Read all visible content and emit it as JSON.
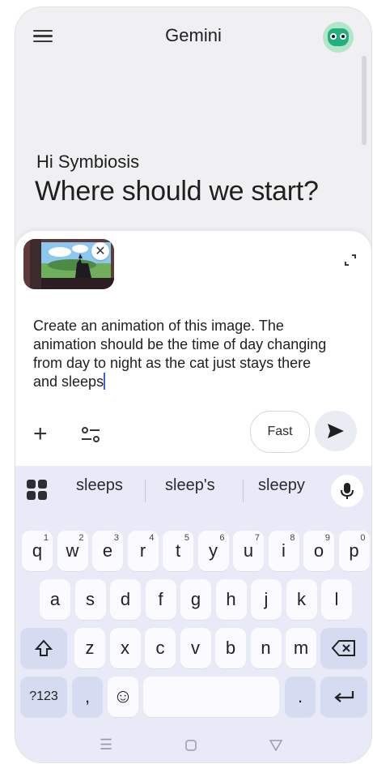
{
  "app": {
    "title": "Gemini"
  },
  "greeting": "Hi Symbiosis",
  "question": "Where should we start?",
  "composer": {
    "prompt_text": "Create an animation of this image. The animation should be the time of day changing from day to night as the cat just stays there and sleeps",
    "fast_label": "Fast",
    "icons": {
      "add": "plus-icon",
      "tools": "tools-icon",
      "send": "send-icon",
      "expand": "expand-icon",
      "remove": "close-icon"
    }
  },
  "keyboard": {
    "suggestions": [
      "sleeps",
      "sleep's",
      "sleepy"
    ],
    "row1": [
      {
        "k": "q",
        "s": "1"
      },
      {
        "k": "w",
        "s": "2"
      },
      {
        "k": "e",
        "s": "3"
      },
      {
        "k": "r",
        "s": "4"
      },
      {
        "k": "t",
        "s": "5"
      },
      {
        "k": "y",
        "s": "6"
      },
      {
        "k": "u",
        "s": "7"
      },
      {
        "k": "i",
        "s": "8"
      },
      {
        "k": "o",
        "s": "9"
      },
      {
        "k": "p",
        "s": "0"
      }
    ],
    "row2": [
      "a",
      "s",
      "d",
      "f",
      "g",
      "h",
      "j",
      "k",
      "l"
    ],
    "row3": [
      "z",
      "x",
      "c",
      "v",
      "b",
      "n",
      "m"
    ],
    "sym_label": "?123",
    "comma_label": ",",
    "period_label": ".",
    "emoji_label": "☺"
  },
  "colors": {
    "accent": "#3b5fd9",
    "keyboard_bg": "#e9eaf7",
    "avatar_green": "#22b07f"
  }
}
